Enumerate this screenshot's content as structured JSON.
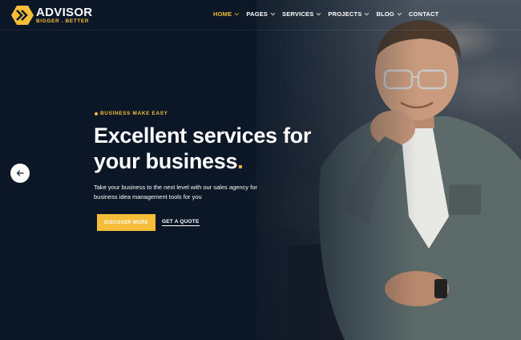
{
  "brand": {
    "name": "ADVISOR",
    "tagline": "BIGGER . BETTER",
    "accent_color": "#f5bd38"
  },
  "nav": {
    "items": [
      {
        "label": "HOME",
        "active": true,
        "has_dropdown": true
      },
      {
        "label": "PAGES",
        "active": false,
        "has_dropdown": true
      },
      {
        "label": "SERVICES",
        "active": false,
        "has_dropdown": true
      },
      {
        "label": "PROJECTS",
        "active": false,
        "has_dropdown": true
      },
      {
        "label": "BLOG",
        "active": false,
        "has_dropdown": true
      },
      {
        "label": "CONTACT",
        "active": false,
        "has_dropdown": false
      }
    ]
  },
  "hero": {
    "tag": "BUSINESS MAKE EASY",
    "headline_line1": "Excellent services for",
    "headline_line2": "your business",
    "headline_dot": ".",
    "description": "Take your business to the next level with our sales agency for business idea management tools for you",
    "primary_button": "DISCOVER MORE",
    "secondary_link": "GET A QUOTE",
    "prev_icon": "arrow-left-icon"
  }
}
